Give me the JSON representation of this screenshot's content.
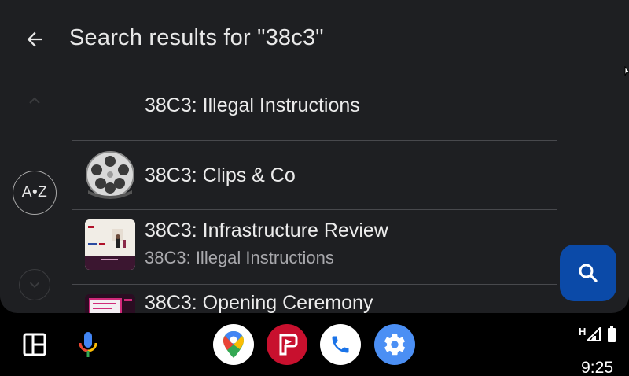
{
  "header": {
    "title": "Search results for \"38c3\""
  },
  "sidebar": {
    "az_label": "A•Z"
  },
  "results": [
    {
      "title": "38C3: Illegal Instructions",
      "subtitle": "",
      "thumb": "none"
    },
    {
      "title": "38C3: Clips & Co",
      "subtitle": "",
      "thumb": "film-reel-icon"
    },
    {
      "title": "38C3: Infrastructure Review",
      "subtitle": "38C3: Illegal Instructions",
      "thumb": "video-thumbnail"
    },
    {
      "title": "38C3: Opening Ceremony",
      "subtitle": "",
      "thumb": "video-thumbnail"
    }
  ],
  "taskbar": {
    "apps": [
      "maps-icon",
      "podcast-addict-icon",
      "phone-icon",
      "settings-icon"
    ],
    "time": "9:25",
    "status_network": "H"
  },
  "colors": {
    "background": "#1e1f22",
    "fab": "#0b4aa8",
    "divider": "#48494d",
    "phone": "#ffffff",
    "settings": "#4b8ff4",
    "podcast": "#c8102e"
  }
}
